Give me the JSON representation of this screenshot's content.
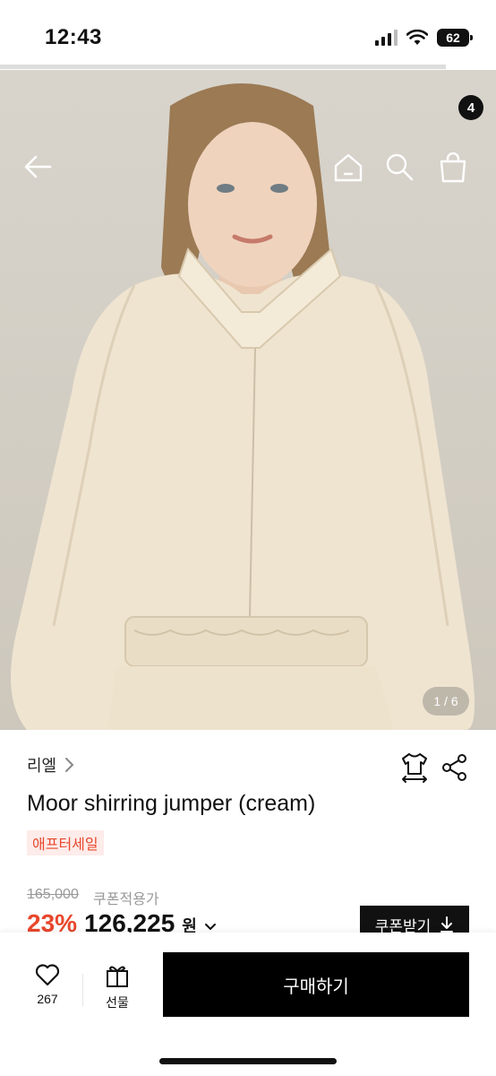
{
  "status": {
    "time": "12:43",
    "battery": "62"
  },
  "header": {
    "back_icon": "arrow-left-icon",
    "home_icon": "home-icon",
    "search_icon": "search-icon",
    "cart_icon": "shopping-bag-icon",
    "cart_count": "4"
  },
  "gallery": {
    "counter": "1 / 6"
  },
  "product": {
    "brand": "리엘",
    "title": "Moor shirring jumper (cream)",
    "tag": "애프터세일",
    "original_price": "165,000",
    "coupon_note": "쿠폰적용가",
    "discount": "23%",
    "price": "126,225",
    "currency": "원",
    "coupon_button": "쿠폰받기"
  },
  "bottom": {
    "like_count": "267",
    "gift_label": "선물",
    "buy_label": "구매하기"
  },
  "colors": {
    "accent": "#e8472c",
    "tag_bg": "#fdecea",
    "button": "#000000"
  }
}
